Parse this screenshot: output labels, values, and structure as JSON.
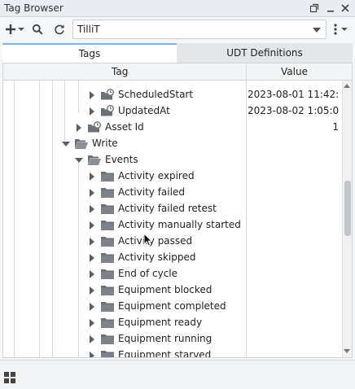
{
  "window": {
    "title": "Tag Browser",
    "restore_icon": "restore-window-icon",
    "minimize_icon": "minimize-icon",
    "close_icon": "close-icon"
  },
  "toolbar": {
    "add_icon": "plus-icon",
    "dropdown_icon": "chevron-down-icon",
    "search_icon": "search-icon",
    "refresh_icon": "refresh-icon",
    "provider_value": "TilliT",
    "more_icon": "vertical-dots-icon"
  },
  "tabs": [
    {
      "label": "Tags",
      "active": true
    },
    {
      "label": "UDT Definitions",
      "active": false
    }
  ],
  "table": {
    "headers": {
      "tag": "Tag",
      "value": "Value"
    },
    "rows": [
      {
        "label": "ScheduledStart",
        "value": "2023-08-01 11:42:...",
        "type": "tag"
      },
      {
        "label": "UpdatedAt",
        "value": "2023-08-02 1:05:0...",
        "type": "tag"
      },
      {
        "label": "Asset Id",
        "value": "1",
        "type": "tag"
      },
      {
        "label": "Write",
        "value": "",
        "type": "folder-open"
      },
      {
        "label": "Events",
        "value": "",
        "type": "folder-open"
      },
      {
        "label": "Activity expired",
        "value": "",
        "type": "folder"
      },
      {
        "label": "Activity failed",
        "value": "",
        "type": "folder"
      },
      {
        "label": "Activity failed retest",
        "value": "",
        "type": "folder"
      },
      {
        "label": "Activity manually started",
        "value": "",
        "type": "folder"
      },
      {
        "label": "Activity passed",
        "value": "",
        "type": "folder"
      },
      {
        "label": "Activity skipped",
        "value": "",
        "type": "folder"
      },
      {
        "label": "End of cycle",
        "value": "",
        "type": "folder"
      },
      {
        "label": "Equipment blocked",
        "value": "",
        "type": "folder"
      },
      {
        "label": "Equipment completed",
        "value": "",
        "type": "folder"
      },
      {
        "label": "Equipment ready",
        "value": "",
        "type": "folder"
      },
      {
        "label": "Equipment running",
        "value": "",
        "type": "folder"
      },
      {
        "label": "Equipment starved",
        "value": "",
        "type": "folder"
      }
    ]
  },
  "statusbar": {
    "layout_icon": "grid-layout-icon"
  }
}
